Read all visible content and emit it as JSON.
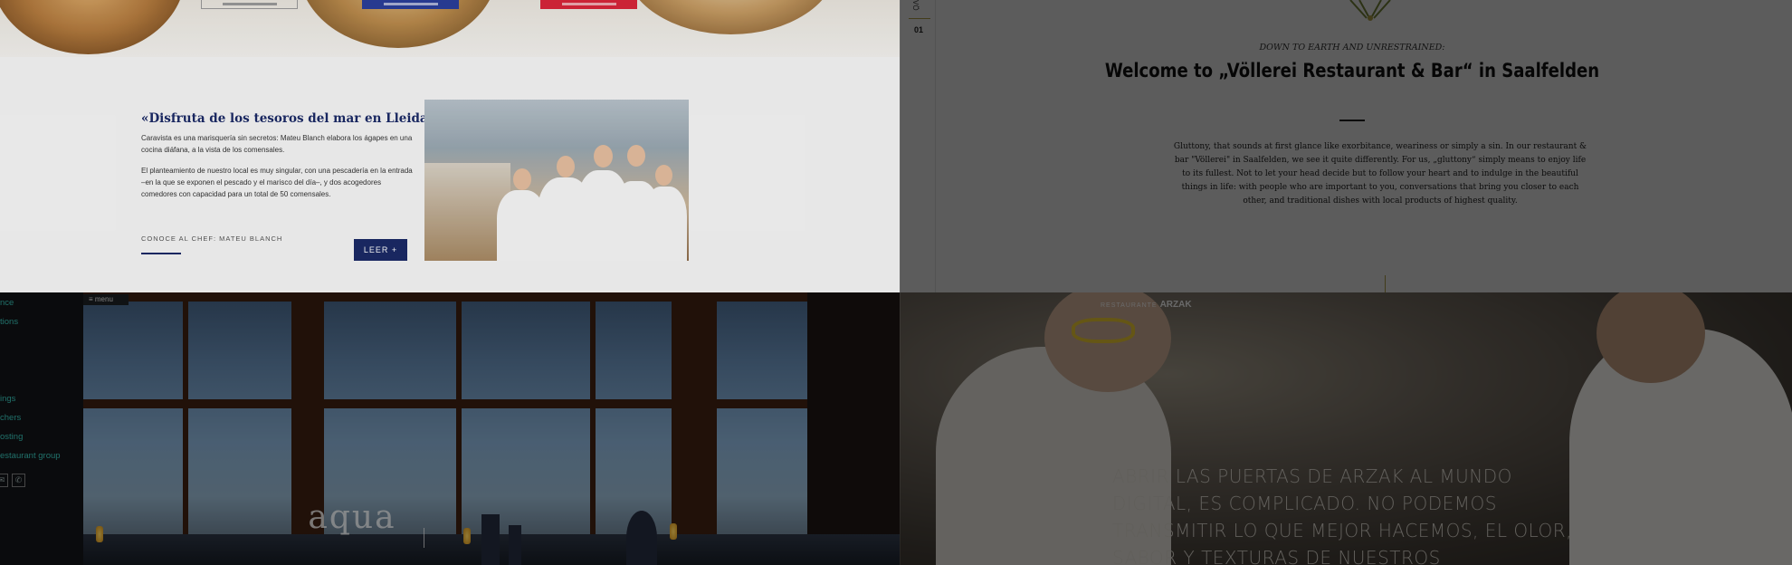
{
  "caravista": {
    "hero_buttons": [
      "",
      "",
      ""
    ],
    "title": "«Disfruta de los tesoros del mar en Lleida»",
    "paragraph_1": "Caravista es una marisquería sin secretos: Mateu Blanch elabora los ágapes en una cocina diáfana, a la vista de los comensales.",
    "paragraph_2": "El planteamiento de nuestro local es muy singular, con una pescadería en la entrada –en la que se exponen el pescado y el marisco del día–, y dos acogedores comedores con capacidad para un total de 50 comensales.",
    "chef_link": "CONOCE AL CHEF: MATEU BLANCH",
    "leer_button": "LEER +",
    "colors": {
      "navy": "#1b2a66",
      "red": "#d8263a",
      "blue": "#2a3e9a"
    }
  },
  "vollerei": {
    "side_label": "VÖ",
    "side_number": "01",
    "kicker": "DOWN TO EARTH AND UNRESTRAINED:",
    "heading": "Welcome to „Völlerei Restaurant & Bar“ in Saalfelden",
    "body": "Gluttony, that sounds at first glance like exorbitance, weariness or simply a sin. In our restaurant & bar \"Völlerei\" in Saalfelden, we see it quite differently. For us, „gluttony“ simply means to enjoy life to its fullest. Not to let your head decide but to follow your heart and to indulge in the beautiful things in life: with people who are important to you, conversations that bring you closer to each other, and traditional dishes with local products of highest quality.",
    "colors": {
      "accent": "#b7a64a"
    }
  },
  "aqua": {
    "menu_label": "menu",
    "nav_links": [
      "nce",
      "tions",
      "ings",
      "chers",
      "osting",
      "estaurant group"
    ],
    "icons": [
      "mail-icon",
      "phone-icon"
    ],
    "logo": "aqua",
    "colors": {
      "link": "#38c1b6"
    }
  },
  "arzak": {
    "brand_prefix": "RESTAURANTE",
    "brand_name": "ARZAK",
    "nav_items": [
      "",
      "",
      ""
    ],
    "headline": "ABRIR LAS PUERTAS DE ARZAK AL MUNDO DIGITAL, ES COMPLICADO. NO PODEMOS TRANSMITIR LO QUE MEJOR HACEMOS, EL OLOR, SABOR Y TEXTURAS DE NUESTROS"
  }
}
